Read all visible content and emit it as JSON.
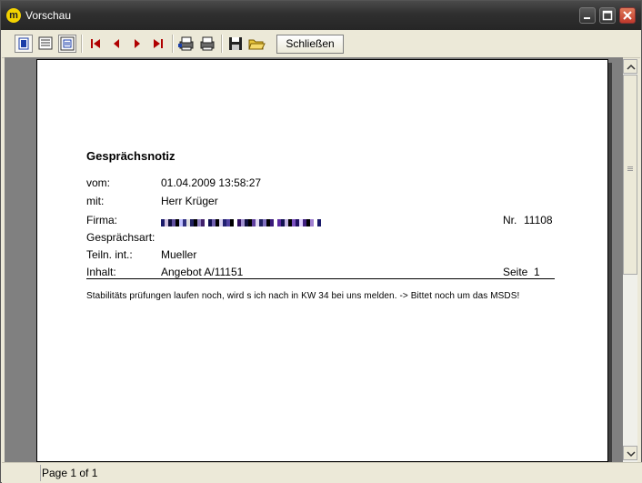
{
  "window": {
    "title": "Vorschau",
    "app_icon_letter": "m"
  },
  "toolbar": {
    "close_label": "Schließen"
  },
  "document": {
    "heading": "Gesprächsnotiz",
    "fields": {
      "vom_label": "vom:",
      "vom_value": "01.04.2009 13:58:27",
      "mit_label": "mit:",
      "mit_value": "Herr Krüger",
      "firma_label": "Firma:",
      "gespraechsart_label": "Gesprächsart:",
      "teiln_label": "Teiln. int.:",
      "teiln_value": "Mueller",
      "inhalt_label": "Inhalt:",
      "inhalt_value": "Angebot A/11151",
      "nr_label": "Nr.",
      "nr_value": "11108",
      "seite_label": "Seite",
      "seite_value": "1"
    },
    "note": "Stabilitäts prüfungen laufen noch, wird s ich nach in KW  34 bei uns melden. -> Bittet noch um das MSDS!"
  },
  "status": {
    "page_text": "Page 1 of 1"
  },
  "colors": {
    "titlebar": "#2f2f2f",
    "accent_close": "#c0392b",
    "toolbar_blue": "#1a3ea8",
    "nav_red": "#b00000"
  }
}
